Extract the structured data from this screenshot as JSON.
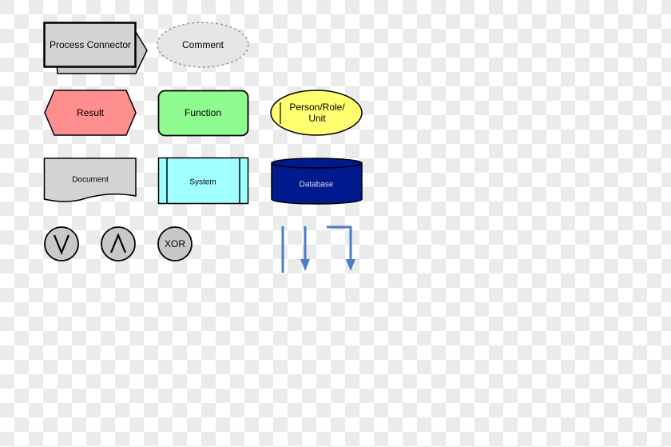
{
  "shapes": {
    "process_connector": "Process Connector",
    "comment": "Comment",
    "result": "Result",
    "function": "Function",
    "person_line1": "Person/Role/",
    "person_line2": "Unit",
    "document": "Document",
    "system": "System",
    "database": "Database",
    "or_symbol": "∨",
    "and_symbol": "∧",
    "xor": "XOR"
  },
  "colors": {
    "result": "#ff8f8f",
    "function": "#8ffc8f",
    "person": "#ffff70",
    "document": "#d4d4d4",
    "system": "#a0ffff",
    "database": "#001a8e",
    "connector": "#4a7cc8",
    "operator": "#c8c8c8"
  }
}
